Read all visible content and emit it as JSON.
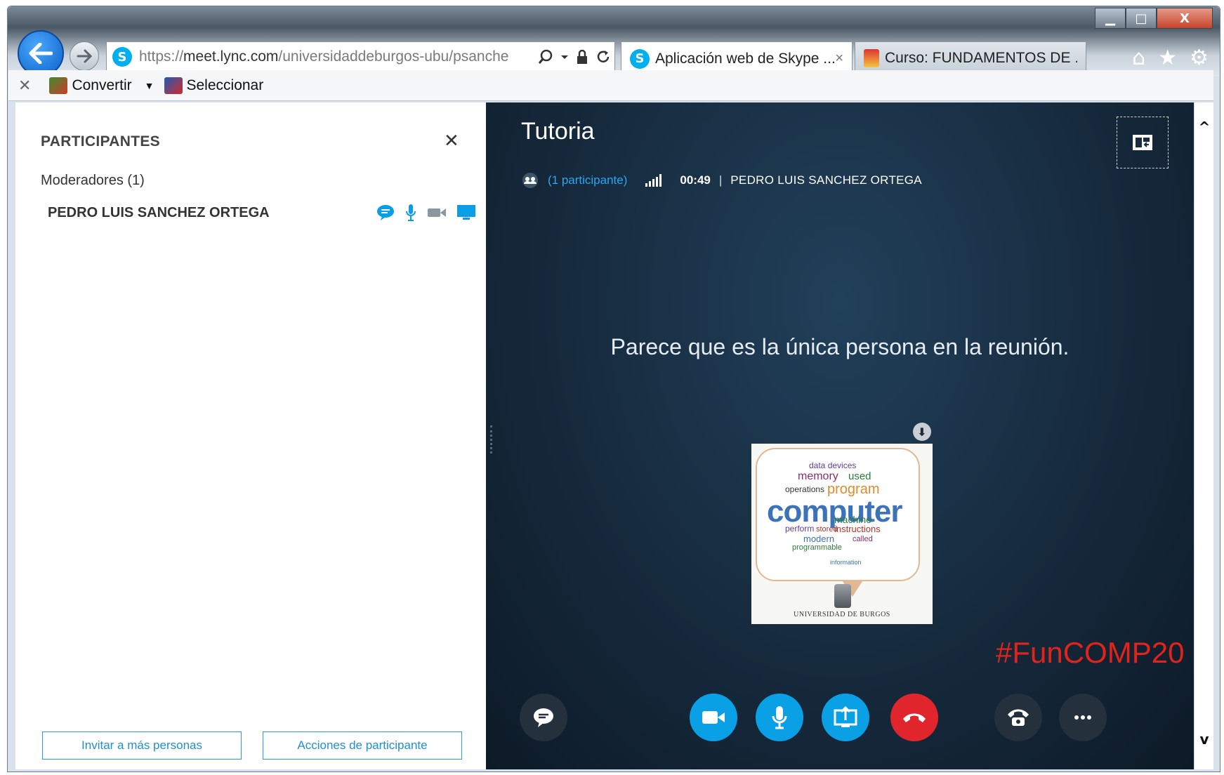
{
  "browser": {
    "url_prefix": "https://",
    "url_host": "meet.lync.com",
    "url_path": "/universidaddeburgos-ubu/psanche",
    "tabs": [
      {
        "label": "Aplicación web de Skype ...",
        "close": "×"
      },
      {
        "label": "Curso: FUNDAMENTOS DE ..."
      }
    ],
    "window_controls": {
      "minimize": "▁",
      "maximize": "□",
      "close": "X"
    },
    "toolbar_icons": {
      "home": "⌂",
      "favorites": "★",
      "settings": "⚙"
    }
  },
  "command_bar": {
    "close": "✕",
    "convert_label": "Convertir",
    "caret": "▼",
    "select_label": "Seleccionar"
  },
  "participants_panel": {
    "title": "PARTICIPANTES",
    "close": "✕",
    "moderators_label": "Moderadores (1)",
    "participant_name": "PEDRO LUIS SANCHEZ ORTEGA",
    "invite_button": "Invitar a más personas",
    "actions_button": "Acciones de participante"
  },
  "meeting": {
    "title": "Tutoria",
    "participants_link": "(1 participante)",
    "timer": "00:49",
    "separator": "|",
    "host": "PEDRO LUIS SANCHEZ ORTEGA",
    "alone_message": "Parece que es la única persona en la reunión.",
    "slide_caption": "UNIVERSIDAD DE BURGOS",
    "slide_download": "⬇",
    "hashtag": "#FunCOMP20"
  },
  "word_cloud": {
    "computer": "computer",
    "program": "program",
    "memory": "memory",
    "used": "used",
    "instructions": "instructions",
    "machine": "machine",
    "modern": "modern",
    "data": "data devices",
    "operations": "operations",
    "perform": "perform",
    "programmable": "programmable",
    "stored": "stored",
    "called": "called",
    "information": "information"
  },
  "scroll": {
    "up": "^",
    "down": "v"
  },
  "colors": {
    "skype_blue": "#00aff0",
    "control_blue": "#0aa0e6",
    "hangup_red": "#e0262c",
    "hashtag_red": "#e2231a",
    "meeting_bg": "#162a3d",
    "link_blue": "#2aa6f2"
  },
  "icons": {
    "back": "arrow-left-icon",
    "forward": "arrow-right-icon",
    "chat": "chat-icon",
    "video": "video-camera-icon",
    "mic": "microphone-icon",
    "share": "screen-share-icon",
    "hangup": "hang-up-icon",
    "dialpad": "phone-icon",
    "more": "more-icon",
    "layout": "layout-icon"
  }
}
